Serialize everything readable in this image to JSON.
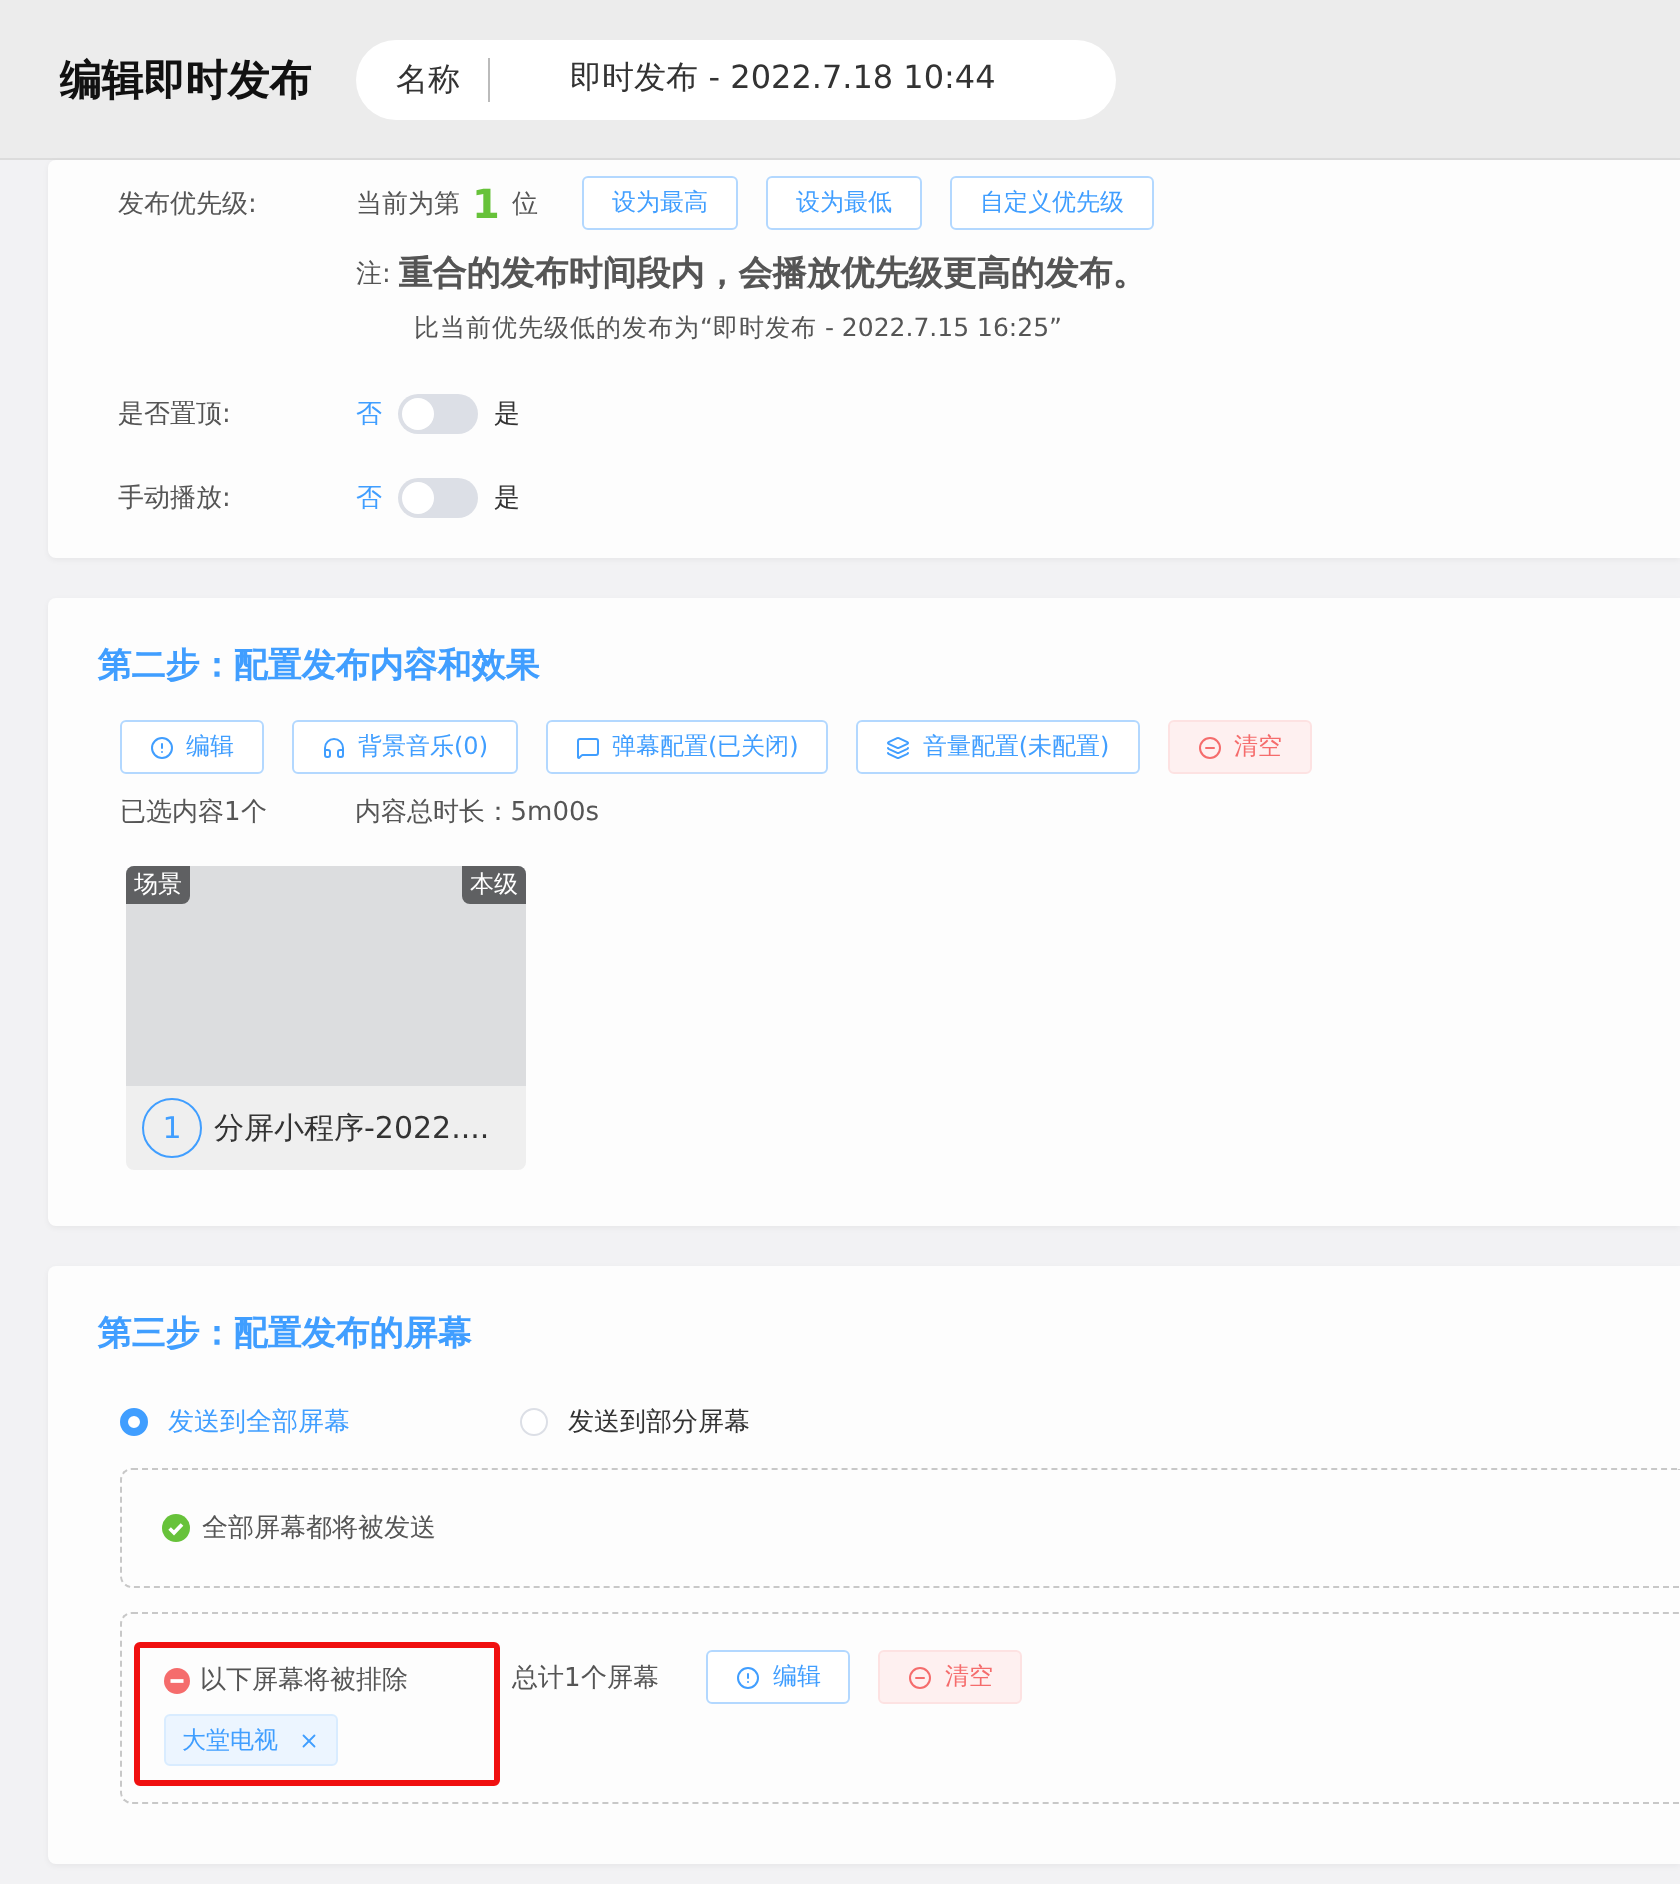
{
  "header": {
    "title": "编辑即时发布",
    "name_field": {
      "label": "名称",
      "value": "即时发布 - 2022.7.18 10:44"
    }
  },
  "basic": {
    "priority": {
      "label": "发布优先级:",
      "prefix": "当前为第",
      "rank": "1",
      "suffix": "位",
      "buttons": [
        "设为最高",
        "设为最低",
        "自定义优先级"
      ],
      "note_label": "注:",
      "note": "重合的发布时间段内，会播放优先级更高的发布。",
      "lower": "比当前优先级低的发布为“即时发布 - 2022.7.15 16:25”"
    },
    "switches": [
      {
        "label": "是否置顶:",
        "off_text": "否",
        "on_text": "是",
        "on": false
      },
      {
        "label": "手动播放:",
        "off_text": "否",
        "on_text": "是",
        "on": false
      }
    ]
  },
  "step2": {
    "title": "第二步：配置发布内容和效果",
    "toolbar": [
      {
        "label": "编辑",
        "kind": "info"
      },
      {
        "label": "背景音乐(0)",
        "kind": "music"
      },
      {
        "label": "弹幕配置(已关闭)",
        "kind": "danmaku"
      },
      {
        "label": "音量配置(未配置)",
        "kind": "volume"
      },
      {
        "label": "清空",
        "kind": "clear"
      }
    ],
    "selected_count": "已选内容1个",
    "duration": "内容总时长：5m00s",
    "items": [
      {
        "type_tag": "场景",
        "level_tag": "本级",
        "index": "1",
        "name": "分屏小程序-2022...."
      }
    ]
  },
  "step3": {
    "title": "第三步：配置发布的屏幕",
    "targets": [
      {
        "label": "发送到全部屏幕",
        "selected": true
      },
      {
        "label": "发送到部分屏幕",
        "selected": false
      }
    ],
    "all_notice": "全部屏幕都将被发送",
    "excluded": {
      "label": "以下屏幕将被排除",
      "total": "总计1个屏幕",
      "buttons": [
        {
          "label": "编辑",
          "kind": "info"
        },
        {
          "label": "清空",
          "kind": "clear"
        }
      ],
      "screens": [
        "大堂电视"
      ]
    }
  }
}
